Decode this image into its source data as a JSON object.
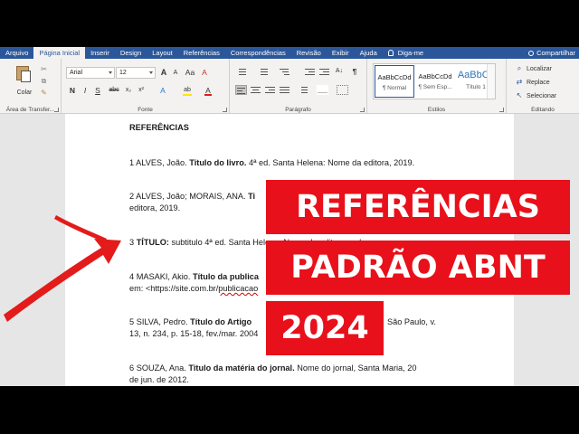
{
  "tabs": [
    "Arquivo",
    "Página Inicial",
    "Inserir",
    "Design",
    "Layout",
    "Referências",
    "Correspondências",
    "Revisão",
    "Exibir",
    "Ajuda"
  ],
  "active_tab_index": 1,
  "tell_me": "Diga-me",
  "share": "Compartilhar",
  "clipboard": {
    "paste_label": "Colar",
    "group_label": "Área de Transfer..."
  },
  "font": {
    "font_name": "Arial",
    "font_size": "12",
    "bold": "N",
    "italic": "I",
    "underline": "S",
    "strike": "abc",
    "subscript": "x₂",
    "superscript": "x²",
    "grow": "A",
    "shrink": "A",
    "case": "Aa",
    "clear": "A",
    "effects": "A",
    "highlight": "ab",
    "color": "A",
    "group_label": "Fonte"
  },
  "paragraph": {
    "pilcrow": "¶",
    "sort": "A↓",
    "group_label": "Parágrafo"
  },
  "styles": {
    "items": [
      {
        "sample": "AaBbCcDd",
        "name": "¶ Normal"
      },
      {
        "sample": "AaBbCcDd",
        "name": "¶ Sem Esp..."
      },
      {
        "sample": "AaBbCc",
        "name": "Título 1"
      }
    ],
    "group_label": "Estilos"
  },
  "editing": {
    "find": "Localizar",
    "replace": "Replace",
    "select": "Selecionar",
    "group_label": "Editando"
  },
  "document": {
    "heading": "REFERÊNCIAS",
    "refs": [
      {
        "num": "1",
        "authors": "ALVES, João.",
        "title": "Titulo do livro.",
        "rest": "4ª ed. Santa Helena: Nome da editora, 2019."
      },
      {
        "num": "2",
        "authors": "ALVES, João; MORAIS, ANA.",
        "title": "Ti",
        "line2": "editora, 2019."
      },
      {
        "num": "3",
        "title": "TÍTULO:",
        "rest": "subtitulo 4ª ed. Santa Helena: Nome da editora, e d"
      },
      {
        "num": "4",
        "authors": "MASAKI, Akio.",
        "title": "Título da publica",
        "line2": "em: <https://site.com.br/",
        "line2_ul": "publicacao"
      },
      {
        "num": "5",
        "authors": "SILVA, Pedro.",
        "title": "Título do Artigo",
        "rest_right": "São Paulo, v.",
        "line2": "13, n. 234, p. 15-18, fev./mar. 2004"
      },
      {
        "num": "6",
        "authors": "SOUZA, Ana.",
        "title": "Titulo da matéria do jornal.",
        "rest": "Nome do jornal, Santa Maria, 20",
        "line2": "de jun. de 2012."
      }
    ]
  },
  "overlay": {
    "line1": "REFERÊNCIAS",
    "line2": "PADRÃO ABNT",
    "line3": "2024"
  },
  "colors": {
    "accent": "#2b579a",
    "banner": "#e8101a",
    "arrow": "#e31b1b"
  }
}
